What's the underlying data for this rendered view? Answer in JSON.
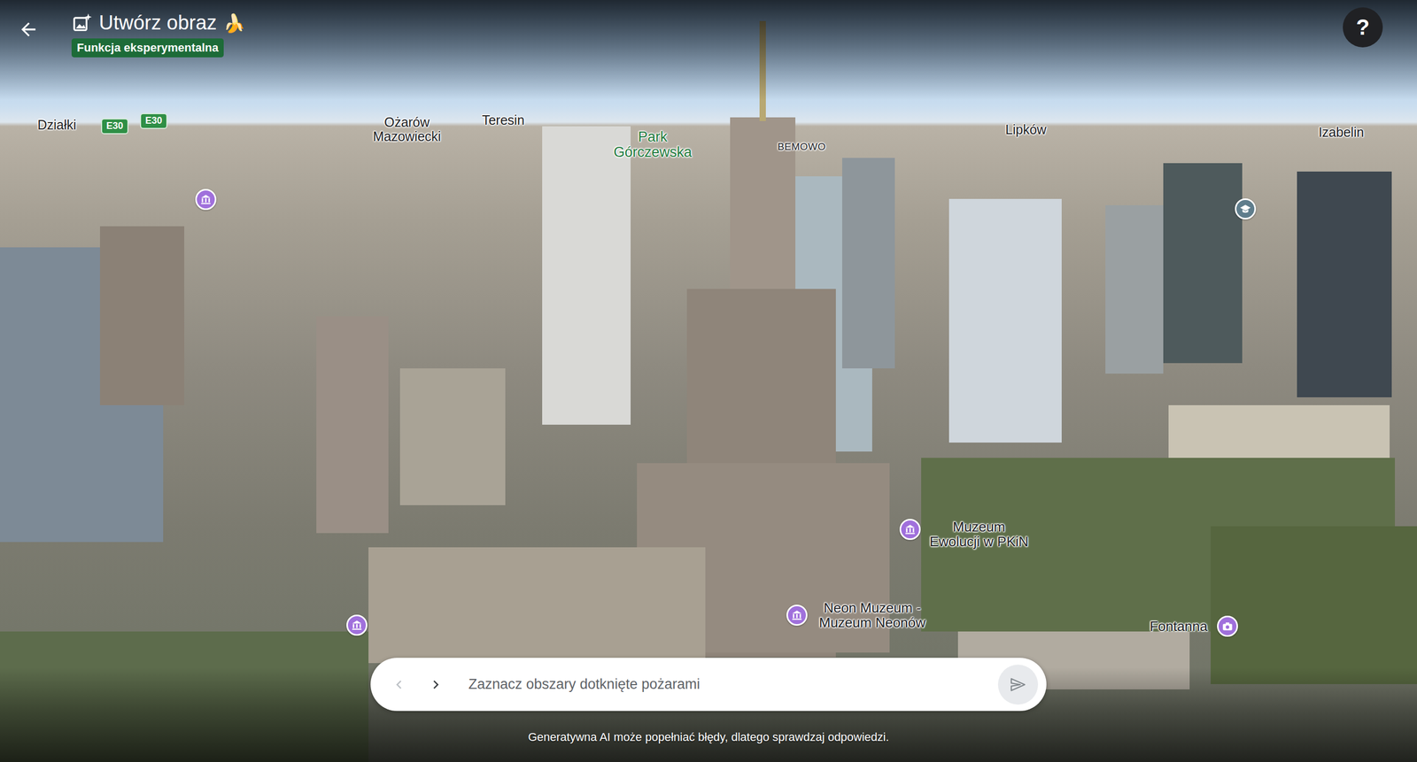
{
  "header": {
    "title": "Utwórz obraz",
    "emoji": "🍌",
    "badge": "Funkcja eksperymentalna"
  },
  "help_button": {
    "label": "?"
  },
  "map": {
    "labels": [
      {
        "lines": [
          "Działki"
        ],
        "kind": "place"
      },
      {
        "lines": [
          "Ożarów",
          "Mazowiecki"
        ],
        "kind": "place"
      },
      {
        "lines": [
          "Teresin"
        ],
        "kind": "place"
      },
      {
        "lines": [
          "Park",
          "Górczewska"
        ],
        "kind": "park"
      },
      {
        "lines": [
          "BEMOWO"
        ],
        "kind": "district"
      },
      {
        "lines": [
          "Lipków"
        ],
        "kind": "place"
      },
      {
        "lines": [
          "Izabelin"
        ],
        "kind": "place"
      },
      {
        "lines": [
          "Muzeum",
          "Ewolucji w PKiN"
        ],
        "kind": "poi"
      },
      {
        "lines": [
          "Neon Muzeum -",
          "Muzeum Neonów"
        ],
        "kind": "poi"
      },
      {
        "lines": [
          "Fontanna"
        ],
        "kind": "poi"
      }
    ],
    "road_shields": [
      {
        "text": "E30"
      },
      {
        "text": "E30"
      }
    ],
    "pins": [
      {
        "kind": "museum",
        "color": "#a070dc"
      },
      {
        "kind": "school",
        "color": "#5f7d8c"
      },
      {
        "kind": "museum",
        "color": "#a070dc"
      },
      {
        "kind": "museum",
        "color": "#a070dc"
      },
      {
        "kind": "museum",
        "color": "#a070dc"
      },
      {
        "kind": "camera",
        "color": "#a070dc"
      }
    ]
  },
  "prompt": {
    "placeholder": "Zaznacz obszary dotknięte pożarami",
    "prev_disabled": true,
    "next_disabled": false,
    "send_disabled": true
  },
  "disclaimer": "Generatywna AI może popełniać błędy, dlatego sprawdzaj odpowiedzi."
}
